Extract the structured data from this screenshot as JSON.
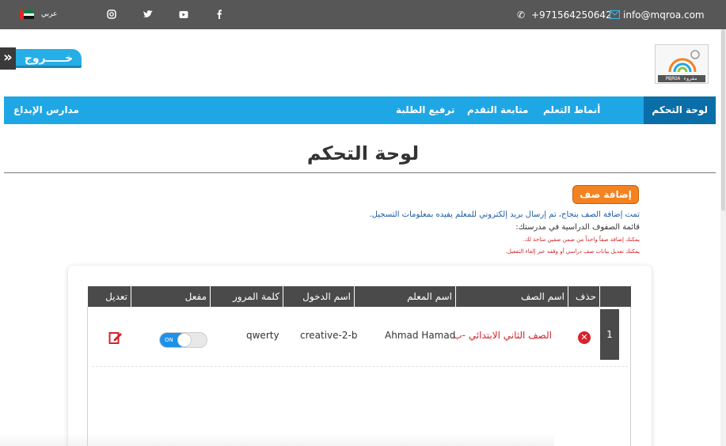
{
  "topbar": {
    "language": "عربي",
    "phone": "+971564250642",
    "email": "info@mqroa.com",
    "social_icons": [
      "instagram-icon",
      "twitter-icon",
      "youtube-icon",
      "facebook-icon"
    ]
  },
  "header": {
    "logout_label": "خـــــروج",
    "logo_text": "MQROA مقروء"
  },
  "nav": {
    "items": [
      "لوحة التحكم",
      "أنماط التعلم",
      "متابعة التقدم",
      "ترفيع الطلبة"
    ],
    "active_index": 0,
    "school_name": "مدارس الإبداع"
  },
  "page": {
    "title": "لوحة التحكم",
    "add_class_button": "إضافة صف",
    "messages": [
      "تمت إضافة الصف بنجاح، تم إرسال بريد إلكتروني للمعلم يفيده بمعلومات التسجيل.",
      "قائمة الصفوف الدراسية في مدرستك:",
      "يمكنك إضافة صفاً واحداً من ضمن صفين متاحة لك.",
      "يمكنك تعديل بيانات صف دراسي أو وقفه عبر إلغاء التفعيل."
    ]
  },
  "table": {
    "headers": [
      "حذف",
      "اسم الصف",
      "اسم المعلم",
      "اسم الدخول",
      "كلمة المرور",
      "مفعل",
      "تعديل"
    ],
    "rows": [
      {
        "num": "1",
        "class_name": "الصف الثاني الابتدائي -ب",
        "teacher": "Ahmad Hamad",
        "login": "creative-2-b",
        "password": "qwerty",
        "toggle_label": "ON"
      }
    ]
  },
  "colors": {
    "topbar": "#575757",
    "nav": "#1ea7e4",
    "nav_active": "#0a6ea8",
    "accent_orange": "#f58220",
    "danger": "#d2232a"
  }
}
